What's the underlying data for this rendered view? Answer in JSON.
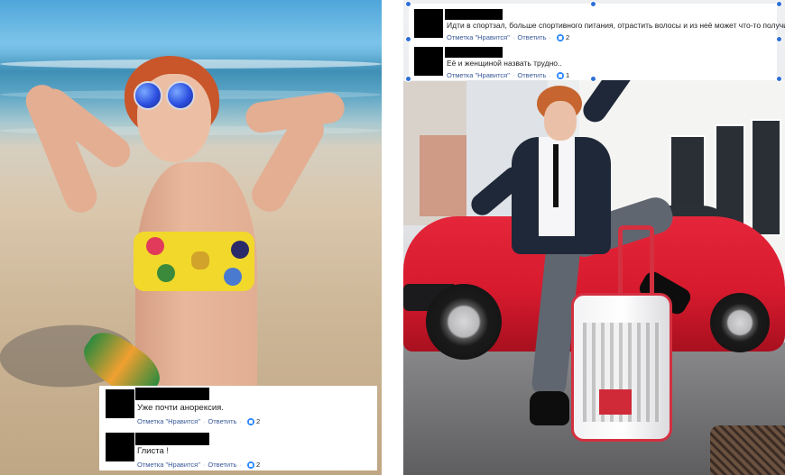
{
  "left_photo": {
    "comments": [
      {
        "text": "Уже почти анорексия.",
        "like_label": "Отметка \"Нравится\"",
        "reply_label": "Ответить",
        "likes": "2"
      },
      {
        "text": "Глиста !",
        "like_label": "Отметка \"Нравится\"",
        "reply_label": "Ответить",
        "likes": "2"
      }
    ]
  },
  "right_photo": {
    "comments": [
      {
        "text": "Идти в спортзал, больше спортивного питания, отрастить волосы и из неё может что-то получиться",
        "like_label": "Отметка \"Нравится\"",
        "reply_label": "Ответить",
        "likes": "2"
      },
      {
        "text": "Её и женщиной назвать трудно..",
        "like_label": "Отметка \"Нравится\"",
        "reply_label": "Ответить",
        "likes": "1"
      }
    ]
  },
  "colors": {
    "link": "#385898",
    "like_badge": "#2d88ff",
    "selection_handle": "#2d6fd6",
    "redaction": "#000000"
  }
}
